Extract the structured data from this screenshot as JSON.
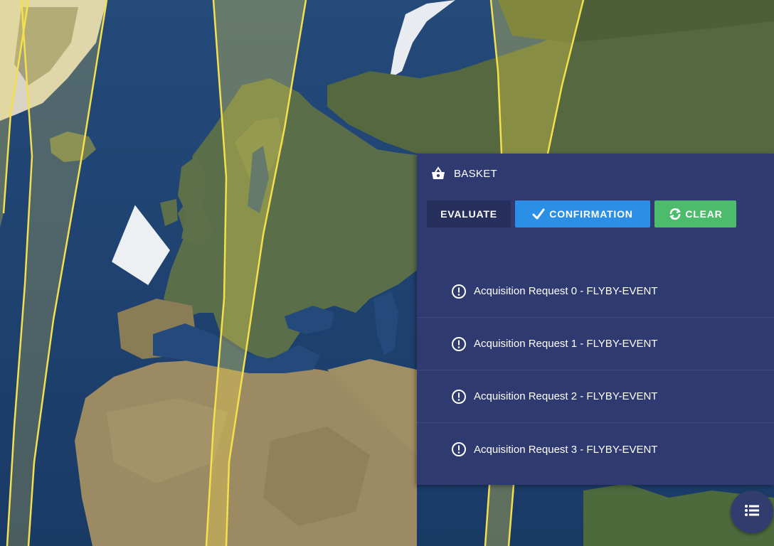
{
  "map": {
    "layer": "satellite-basemap"
  },
  "basket": {
    "icon": "basket-icon",
    "title": "BASKET",
    "buttons": {
      "evaluate_label": "EVALUATE",
      "confirmation_label": "CONFIRMATION",
      "confirmation_icon": "checkmark-icon",
      "clear_label": "CLEAR",
      "clear_icon": "refresh-icon"
    },
    "requests": [
      {
        "label": "Acquisition Request 0 - FLYBY-EVENT",
        "icon": "info-icon"
      },
      {
        "label": "Acquisition Request 1 - FLYBY-EVENT",
        "icon": "info-icon"
      },
      {
        "label": "Acquisition Request 2 - FLYBY-EVENT",
        "icon": "info-icon"
      },
      {
        "label": "Acquisition Request 3 - FLYBY-EVENT",
        "icon": "info-icon"
      }
    ]
  },
  "fab": {
    "icon": "list-icon"
  },
  "colors": {
    "panel_bg": "#2f3b70",
    "evaluate_bg": "#27305d",
    "confirmation_bg": "#2b8fe6",
    "clear_bg": "#4cbb6c",
    "swath_stroke": "#f4e04d",
    "ocean": "#1d3f6e"
  }
}
